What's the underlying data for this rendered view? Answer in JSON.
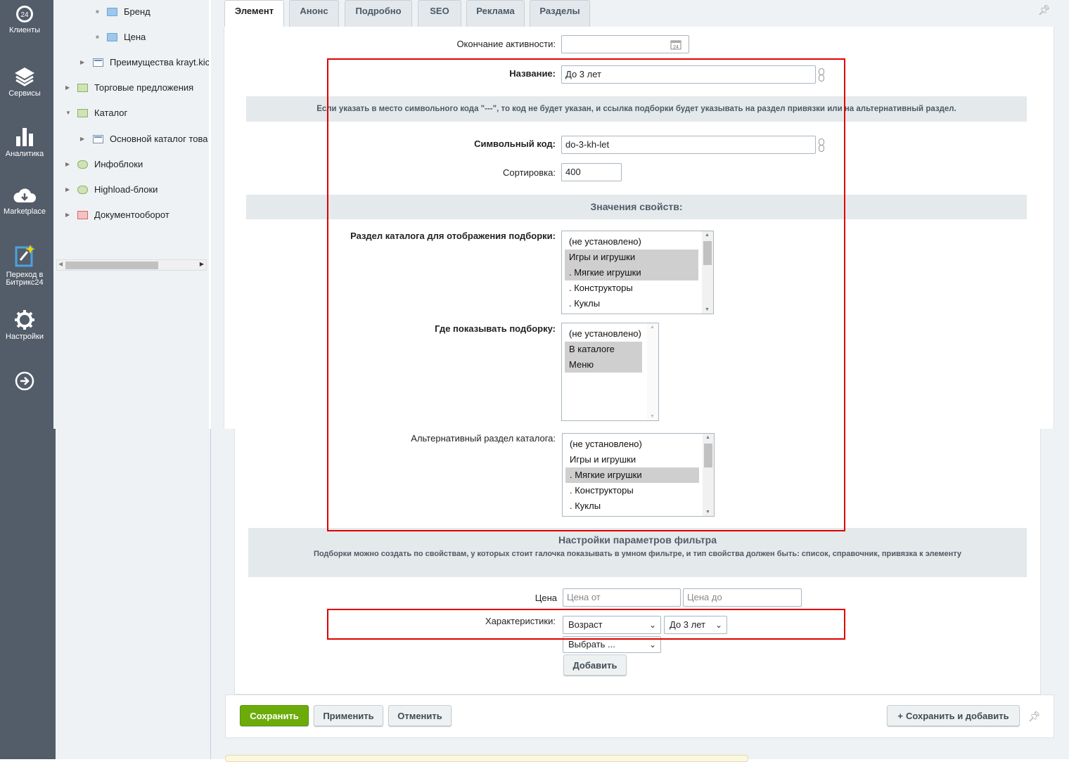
{
  "leftbar": {
    "items": [
      {
        "label": "Клиенты",
        "icon": "crm-24-icon"
      },
      {
        "label": "Сервисы",
        "icon": "layers-icon"
      },
      {
        "label": "Аналитика",
        "icon": "bar-chart-icon"
      },
      {
        "label": "Marketplace",
        "icon": "cloud-download-icon"
      },
      {
        "label": "Переход в Битрикс24",
        "icon": "bitrix-star-icon",
        "label2": "Битрикс24",
        "label1": "Переход в"
      },
      {
        "label": "Настройки",
        "icon": "gear-icon"
      },
      {
        "label": "",
        "icon": "arrow-right-circle-icon"
      }
    ]
  },
  "tree": {
    "items": [
      {
        "label": "Бренд",
        "icon": "folder-icon"
      },
      {
        "label": "Цена",
        "icon": "folder-icon"
      },
      {
        "label": "Преимущества krayt.kic",
        "icon": "infoblock-icon"
      },
      {
        "label": "Торговые предложения",
        "icon": "iblock-type-icon"
      },
      {
        "label": "Каталог",
        "icon": "iblock-type-icon"
      },
      {
        "label": "Основной каталог това",
        "icon": "infoblock-icon"
      },
      {
        "label": "Инфоблоки",
        "icon": "infoblocks-icon"
      },
      {
        "label": "Highload-блоки",
        "icon": "highload-icon"
      },
      {
        "label": "Документооборот",
        "icon": "workflow-icon"
      }
    ]
  },
  "tabs": [
    "Элемент",
    "Анонс",
    "Подробно",
    "SEO",
    "Реклама",
    "Разделы"
  ],
  "form": {
    "active_to_label": "Окончание активности:",
    "active_to_value": "",
    "name_label": "Название:",
    "name_value": "До 3 лет",
    "code_hint": "Если указать в место символьного кода \"---\", то код не будет указан, и ссылка подборки будет указывать на раздел привязки или на альтернативный раздел.",
    "code_label": "Символьный код:",
    "code_value": "do-3-kh-let",
    "sort_label": "Сортировка:",
    "sort_value": "400",
    "props_header": "Значения свойств:",
    "section_label": "Раздел каталога для отображения подборки:",
    "section_options": [
      {
        "text": "(не установлено)",
        "selected": false
      },
      {
        "text": "Игры и игрушки",
        "selected": true
      },
      {
        "text": ". Мягкие игрушки",
        "selected": true
      },
      {
        "text": ". Конструкторы",
        "selected": false
      },
      {
        "text": ". Куклы",
        "selected": false
      }
    ],
    "where_label": "Где показывать подборку:",
    "where_options": [
      {
        "text": "(не установлено)",
        "selected": false
      },
      {
        "text": "В каталоге",
        "selected": true
      },
      {
        "text": "Меню",
        "selected": true
      }
    ],
    "alt_label": "Альтернативный раздел каталога:",
    "alt_options": [
      {
        "text": "(не установлено)",
        "selected": false
      },
      {
        "text": "Игры и игрушки",
        "selected": false
      },
      {
        "text": ". Мягкие игрушки",
        "selected": true
      },
      {
        "text": ". Конструкторы",
        "selected": false
      },
      {
        "text": ". Куклы",
        "selected": false
      }
    ],
    "filter_title": "Настройки параметров фильтра",
    "filter_hint": "Подборки можно создать по свойствам, у которых стоит галочка показывать в умном фильтре, и тип свойства должен быть: список, справочник, привязка к элементу",
    "price_label": "Цена",
    "price_from_placeholder": "Цена от",
    "price_to_placeholder": "Цена до",
    "char_label": "Характеристики:",
    "char_prop": "Возраст",
    "char_value": "До 3 лет",
    "char_new": "Выбрать ...",
    "add_button": "Добавить"
  },
  "buttons": {
    "save": "Сохранить",
    "apply": "Применить",
    "cancel": "Отменить",
    "save_add": "Сохранить и добавить"
  },
  "colors": {
    "sidebar": "#535c69",
    "save_green": "#6cac0a",
    "highlight_red": "#e00000"
  }
}
